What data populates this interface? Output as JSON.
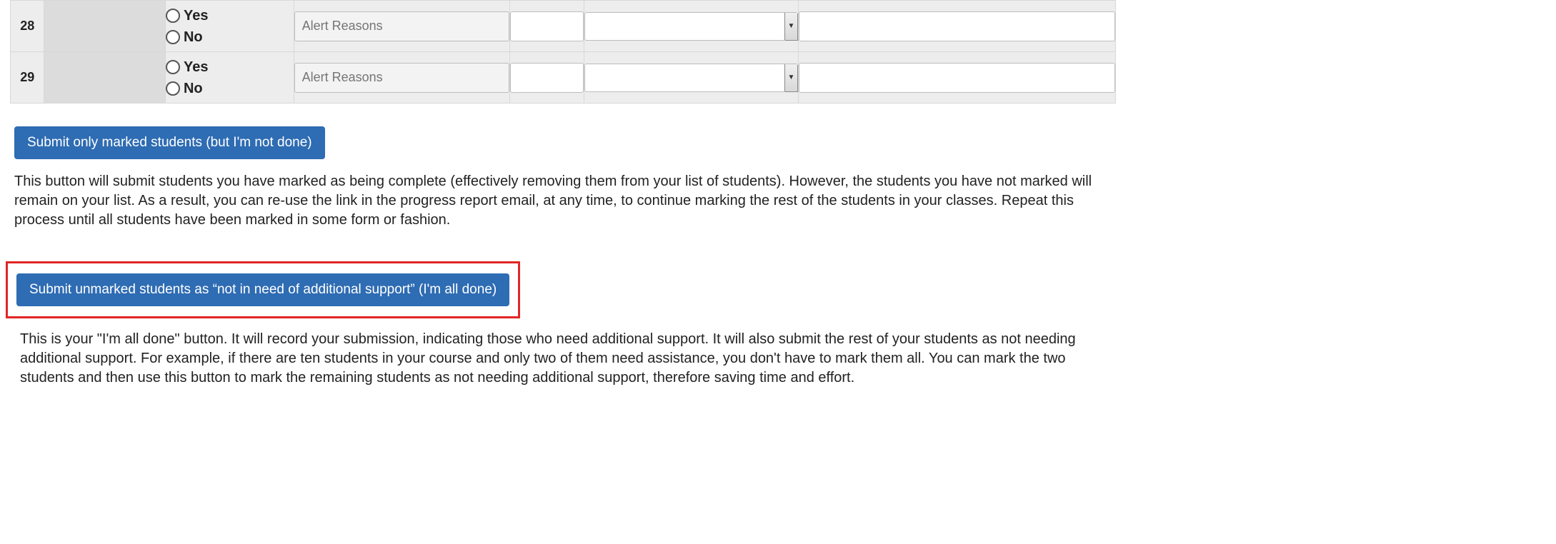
{
  "table": {
    "rows": [
      {
        "num": "28"
      },
      {
        "num": "29"
      }
    ],
    "yes_label": "Yes",
    "no_label": "No",
    "alert_placeholder": "Alert Reasons"
  },
  "button1": {
    "label": "Submit only marked students (but I'm not done)"
  },
  "desc1": "This button will submit students you have marked as being complete (effectively removing them from your list of students). However, the students you have not marked will remain on your list. As a result, you can re-use the link in the progress report email, at any time, to continue marking the rest of the students in your classes. Repeat this process until all students have been marked in some form or fashion.",
  "button2": {
    "label": "Submit unmarked students as “not in need of additional support” (I'm all done)"
  },
  "desc2": "This is your \"I'm all done\" button. It will record your submission, indicating those who need additional support. It will also submit the rest of your students as not needing additional support. For example, if there are ten students in your course and only two of them need assistance, you don't have to mark them all. You can mark the two students and then use this button to mark the remaining students as not needing additional support, therefore saving time and effort."
}
